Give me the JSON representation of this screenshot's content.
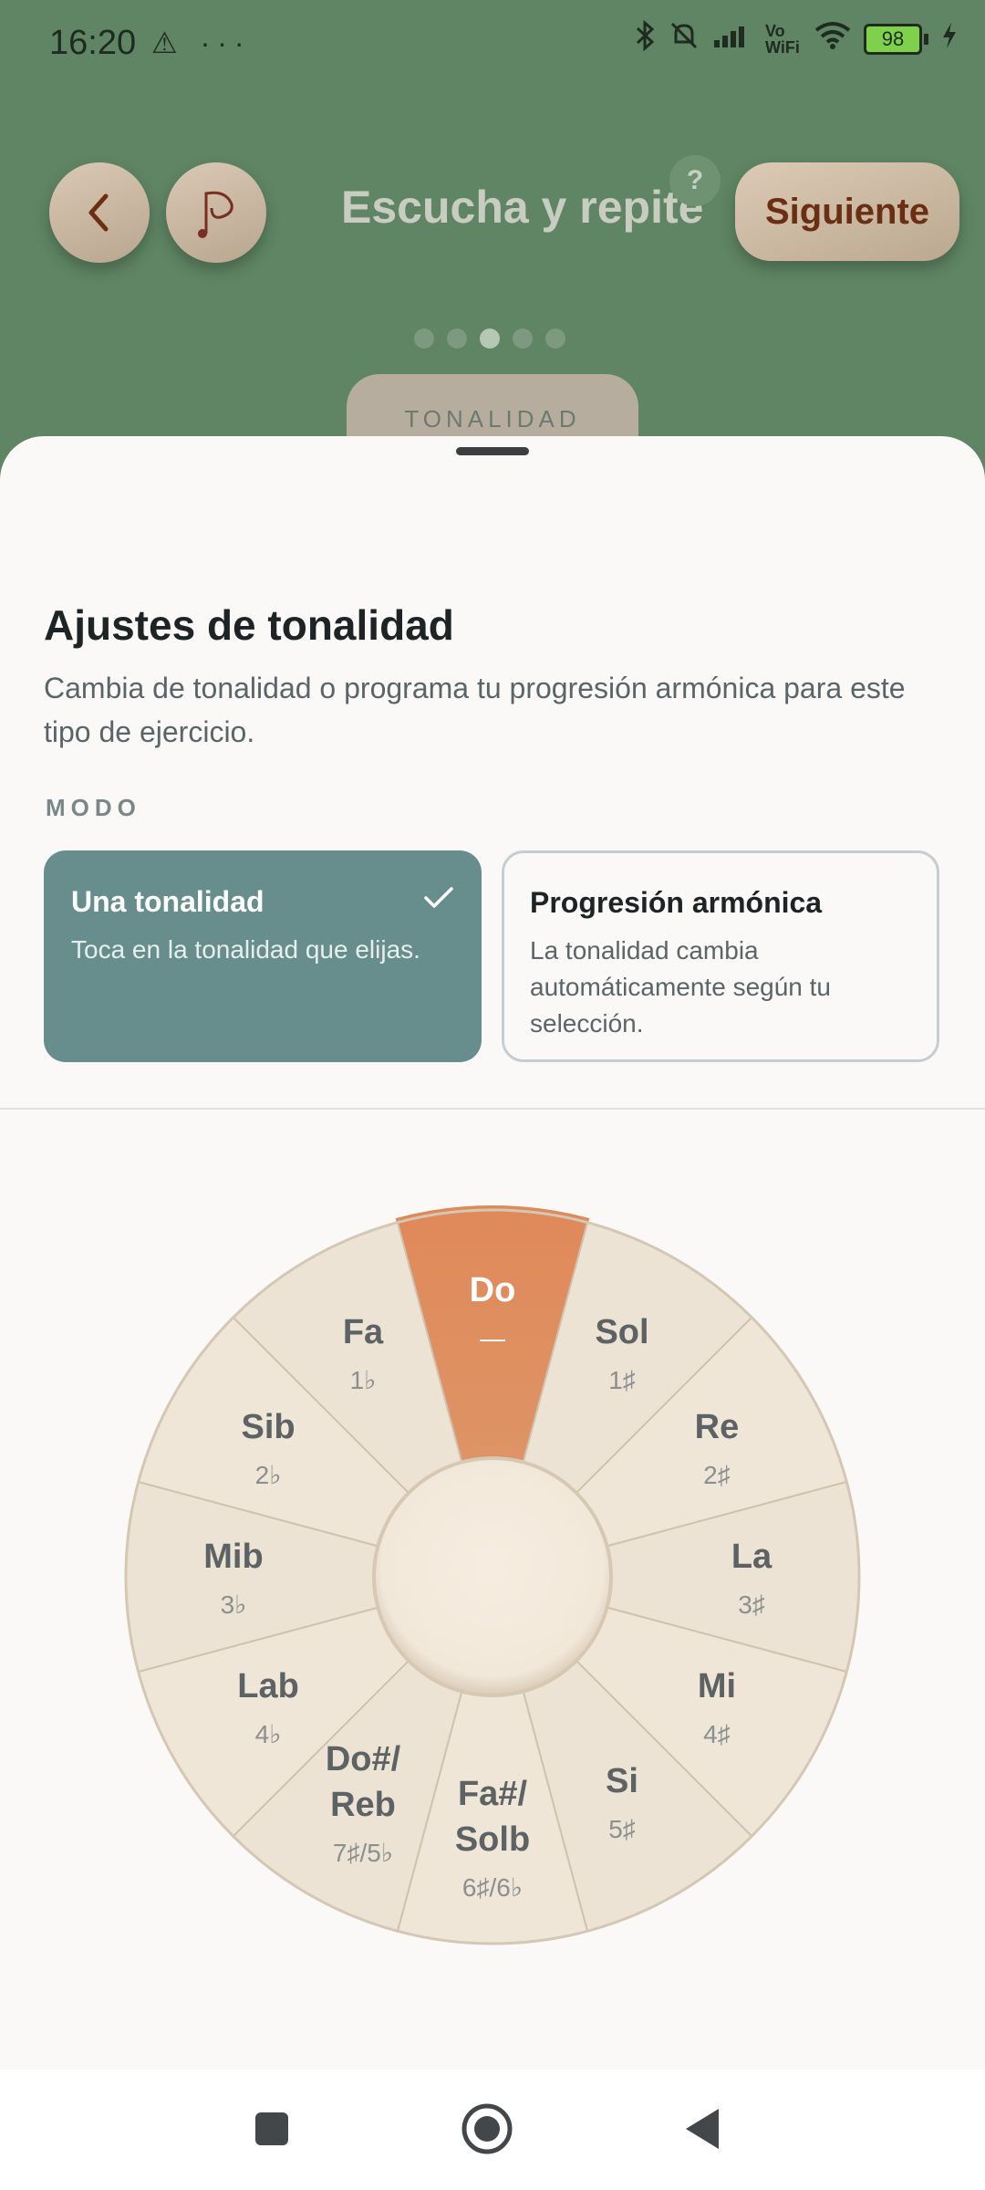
{
  "status_bar": {
    "time": "16:20",
    "left_icons": "⚠ ···",
    "signal": "📶",
    "volte": "Vo WiFi",
    "battery": "98"
  },
  "header": {
    "title": "Escucha y repite",
    "help": "?",
    "next_label": "Siguiente",
    "chip_label": "TONALIDAD"
  },
  "sheet": {
    "title": "Ajustes de tonalidad",
    "description": "Cambia de tonalidad o programa tu progresión armónica para este tipo de ejercicio.",
    "mode_label": "MODO",
    "modes": [
      {
        "title": "Una tonalidad",
        "desc": "Toca en la tonalidad que elijas.",
        "selected": true
      },
      {
        "title": "Progresión armónica",
        "desc": "La tonalidad cambia automáticamente según tu selección.",
        "selected": false
      }
    ]
  },
  "circle_of_fifths": {
    "selected": "Do",
    "keys": [
      {
        "name": "Do",
        "sig": "—"
      },
      {
        "name": "Sol",
        "sig": "1♯"
      },
      {
        "name": "Re",
        "sig": "2♯"
      },
      {
        "name": "La",
        "sig": "3♯"
      },
      {
        "name": "Mi",
        "sig": "4♯"
      },
      {
        "name": "Si",
        "sig": "5♯"
      },
      {
        "name": "Fa#/ Solb",
        "sig": "6♯/6♭"
      },
      {
        "name": "Do#/ Reb",
        "sig": "7♯/5♭"
      },
      {
        "name": "Lab",
        "sig": "4♭"
      },
      {
        "name": "Mib",
        "sig": "3♭"
      },
      {
        "name": "Sib",
        "sig": "2♭"
      },
      {
        "name": "Fa",
        "sig": "1♭"
      }
    ]
  },
  "colors": {
    "accent_selected_segment": "#dd8a58",
    "selected_card": "#678d8d",
    "app_background": "#5f8564"
  },
  "icons": {
    "back": "chevron-left-icon",
    "avatar": "music-note-logo-icon",
    "check": "check-icon",
    "nav_recent": "square-icon",
    "nav_home": "circle-icon",
    "nav_back": "triangle-back-icon"
  }
}
